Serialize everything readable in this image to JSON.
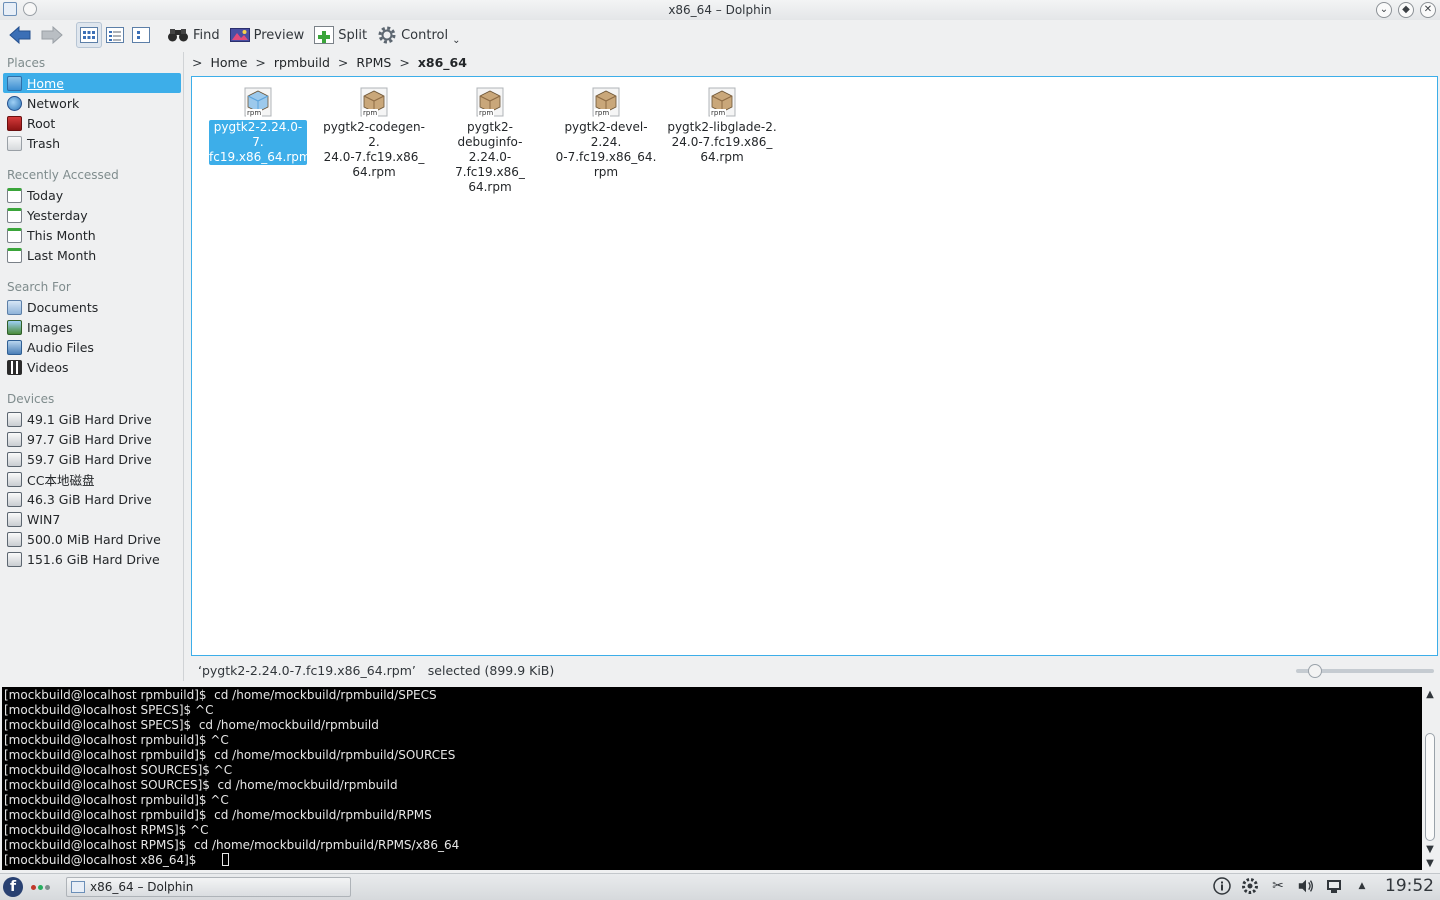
{
  "window": {
    "title": "x86_64 – Dolphin"
  },
  "toolbar": {
    "find_label": "Find",
    "preview_label": "Preview",
    "split_label": "Split",
    "control_label": "Control"
  },
  "places": {
    "groups": [
      {
        "title": "Places",
        "items": [
          {
            "label": "Home",
            "icon": "home-folder-icon",
            "selected": true
          },
          {
            "label": "Network",
            "icon": "network-icon"
          },
          {
            "label": "Root",
            "icon": "root-folder-icon"
          },
          {
            "label": "Trash",
            "icon": "trash-icon"
          }
        ]
      },
      {
        "title": "Recently Accessed",
        "items": [
          {
            "label": "Today",
            "icon": "calendar-icon"
          },
          {
            "label": "Yesterday",
            "icon": "calendar-icon"
          },
          {
            "label": "This Month",
            "icon": "calendar-icon"
          },
          {
            "label": "Last Month",
            "icon": "calendar-icon"
          }
        ]
      },
      {
        "title": "Search For",
        "items": [
          {
            "label": "Documents",
            "icon": "documents-icon"
          },
          {
            "label": "Images",
            "icon": "images-icon"
          },
          {
            "label": "Audio Files",
            "icon": "audio-icon"
          },
          {
            "label": "Videos",
            "icon": "video-icon"
          }
        ]
      },
      {
        "title": "Devices",
        "items": [
          {
            "label": "49.1 GiB Hard Drive",
            "icon": "hard-drive-icon"
          },
          {
            "label": "97.7 GiB Hard Drive",
            "icon": "hard-drive-icon"
          },
          {
            "label": "59.7 GiB Hard Drive",
            "icon": "hard-drive-icon"
          },
          {
            "label": "CC本地磁盘",
            "icon": "hard-drive-icon"
          },
          {
            "label": "46.3 GiB Hard Drive",
            "icon": "hard-drive-icon"
          },
          {
            "label": "WIN7",
            "icon": "hard-drive-icon"
          },
          {
            "label": "500.0 MiB Hard Drive",
            "icon": "hard-drive-icon"
          },
          {
            "label": "151.6 GiB Hard Drive",
            "icon": "hard-drive-icon"
          }
        ]
      }
    ]
  },
  "breadcrumb": [
    "Home",
    "rpmbuild",
    "RPMS",
    "x86_64"
  ],
  "files": [
    {
      "name": "pygtk2-2.24.0-7.\nfc19.x86_64.rpm",
      "selected": true
    },
    {
      "name": "pygtk2-codegen-2.\n24.0-7.fc19.x86_\n64.rpm"
    },
    {
      "name": "pygtk2-debuginfo-\n2.24.0-7.fc19.x86_\n64.rpm"
    },
    {
      "name": "pygtk2-devel-2.24.\n0-7.fc19.x86_64.\nrpm"
    },
    {
      "name": "pygtk2-libglade-2.\n24.0-7.fc19.x86_\n64.rpm"
    }
  ],
  "file_icon_label": "rpm",
  "statusbar": {
    "text": "‘pygtk2-2.24.0-7.fc19.x86_64.rpm’   selected (899.9 KiB)",
    "zoom": 0.1
  },
  "terminal": {
    "lines": [
      "[mockbuild@localhost rpmbuild]$  cd /home/mockbuild/rpmbuild/SPECS",
      "[mockbuild@localhost SPECS]$ ^C",
      "[mockbuild@localhost SPECS]$  cd /home/mockbuild/rpmbuild",
      "[mockbuild@localhost rpmbuild]$ ^C",
      "[mockbuild@localhost rpmbuild]$  cd /home/mockbuild/rpmbuild/SOURCES",
      "[mockbuild@localhost SOURCES]$ ^C",
      "[mockbuild@localhost SOURCES]$  cd /home/mockbuild/rpmbuild",
      "[mockbuild@localhost rpmbuild]$ ^C",
      "[mockbuild@localhost rpmbuild]$  cd /home/mockbuild/rpmbuild/RPMS",
      "[mockbuild@localhost RPMS]$ ^C",
      "[mockbuild@localhost RPMS]$  cd /home/mockbuild/rpmbuild/RPMS/x86_64"
    ],
    "prompt": "[mockbuild@localhost x86_64]$"
  },
  "taskbar": {
    "task_label": "x86_64 – Dolphin",
    "launcher_glyph": "f",
    "clock": "19:52"
  }
}
